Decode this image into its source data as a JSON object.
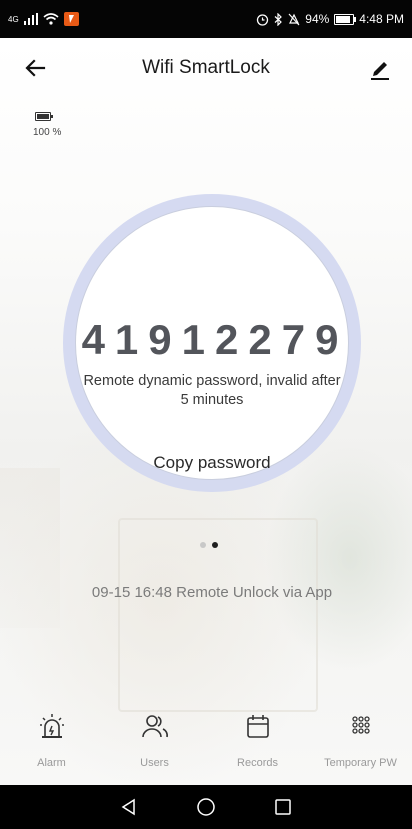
{
  "status_bar": {
    "network": "4G",
    "battery_percent": "94%",
    "time": "4:48 PM"
  },
  "header": {
    "title": "Wifi SmartLock",
    "back_icon": "arrow-left-icon",
    "edit_icon": "pencil-icon"
  },
  "lock": {
    "battery_text": "100 %"
  },
  "password_panel": {
    "password": "41912279",
    "note": "Remote dynamic password, invalid after 5 minutes",
    "copy_label": "Copy password"
  },
  "pager": {
    "count": 2,
    "active_index": 1
  },
  "last_record": "09-15 16:48  Remote Unlock via App",
  "toolbar": [
    {
      "label": "Alarm",
      "icon": "alarm-siren-icon"
    },
    {
      "label": "Users",
      "icon": "users-icon"
    },
    {
      "label": "Records",
      "icon": "calendar-icon"
    },
    {
      "label": "Temporary PW",
      "icon": "keypad-icon"
    }
  ],
  "colors": {
    "ring": "#d3d8f0",
    "password_text": "#53555b",
    "status_badge": "#e85a16"
  }
}
